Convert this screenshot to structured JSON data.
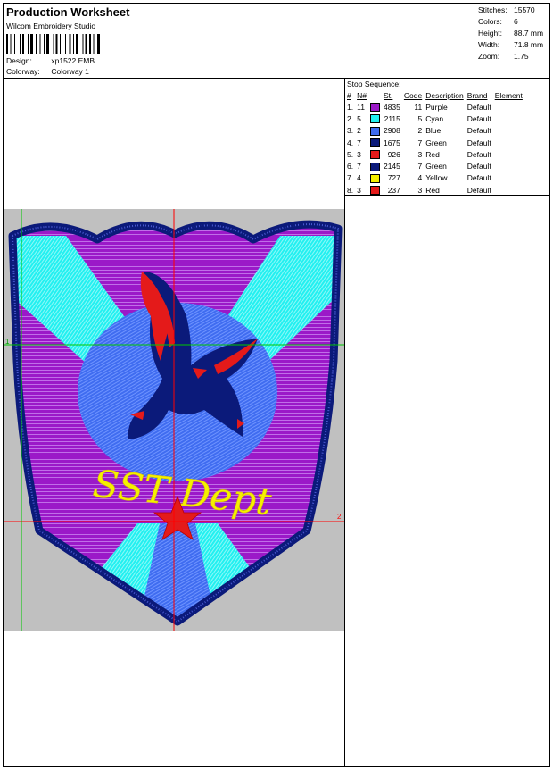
{
  "header": {
    "title": "Production Worksheet",
    "subtitle": "Wilcom Embroidery Studio",
    "design_label": "Design:",
    "design_value": "xp1522.EMB",
    "colorway_label": "Colorway:",
    "colorway_value": "Colorway 1"
  },
  "stats": [
    {
      "label": "Stitches:",
      "value": "15570"
    },
    {
      "label": "Colors:",
      "value": "6"
    },
    {
      "label": "Height:",
      "value": "88.7 mm"
    },
    {
      "label": "Width:",
      "value": "71.8 mm"
    },
    {
      "label": "Zoom:",
      "value": "1.75"
    }
  ],
  "stop_sequence": {
    "title": "Stop Sequence:",
    "columns": [
      "#",
      "N#",
      "St.",
      "Code",
      "Description",
      "Brand",
      "Element"
    ],
    "rows": [
      {
        "num": "1.",
        "n": "11",
        "color": "#9b19c8",
        "st": "4835",
        "code": "11",
        "desc": "Purple",
        "brand": "Default",
        "element": ""
      },
      {
        "num": "2.",
        "n": "5",
        "color": "#22f0f0",
        "st": "2115",
        "code": "5",
        "desc": "Cyan",
        "brand": "Default",
        "element": ""
      },
      {
        "num": "3.",
        "n": "2",
        "color": "#3f6cf0",
        "st": "2908",
        "code": "2",
        "desc": "Blue",
        "brand": "Default",
        "element": ""
      },
      {
        "num": "4.",
        "n": "7",
        "color": "#0b1a7a",
        "st": "1675",
        "code": "7",
        "desc": "Green",
        "brand": "Default",
        "element": ""
      },
      {
        "num": "5.",
        "n": "3",
        "color": "#e41a1a",
        "st": "926",
        "code": "3",
        "desc": "Red",
        "brand": "Default",
        "element": ""
      },
      {
        "num": "6.",
        "n": "7",
        "color": "#0b1a7a",
        "st": "2145",
        "code": "7",
        "desc": "Green",
        "brand": "Default",
        "element": ""
      },
      {
        "num": "7.",
        "n": "4",
        "color": "#f5f000",
        "st": "727",
        "code": "4",
        "desc": "Yellow",
        "brand": "Default",
        "element": ""
      },
      {
        "num": "8.",
        "n": "3",
        "color": "#e41a1a",
        "st": "237",
        "code": "3",
        "desc": "Red",
        "brand": "Default",
        "element": ""
      }
    ]
  },
  "design_preview": {
    "lettering": "SST Dept",
    "guide_labels": [
      "1",
      "2"
    ],
    "colors": {
      "background": "#c0c0c0",
      "purple": "#9b19c8",
      "cyan": "#22f0f0",
      "blue": "#3f6cf0",
      "navy": "#0b1a7a",
      "red": "#e41a1a",
      "yellow": "#f5f000",
      "guide_red": "#ff0000",
      "guide_green": "#00c800"
    }
  }
}
